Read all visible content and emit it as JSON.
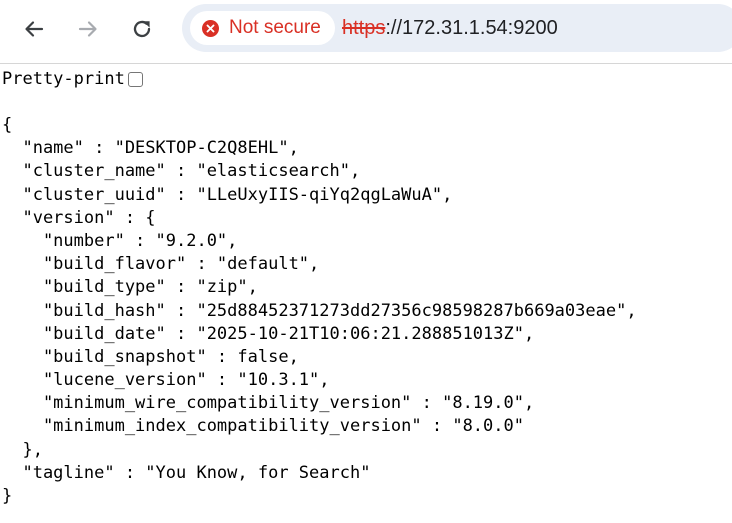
{
  "browser": {
    "security_label": "Not secure",
    "url_scheme": "https",
    "url_rest": "://172.31.1.54:9200",
    "colors": {
      "warning_red": "#d93025",
      "omnibox_bg": "#e9eef6"
    },
    "icons": [
      "back-arrow-icon",
      "forward-arrow-icon",
      "reload-icon",
      "not-secure-warning-icon"
    ]
  },
  "page": {
    "pretty_print_label": "Pretty-print",
    "pretty_print_checked": false,
    "json_lines": [
      "{",
      "  \"name\" : \"DESKTOP-C2Q8EHL\",",
      "  \"cluster_name\" : \"elasticsearch\",",
      "  \"cluster_uuid\" : \"LLeUxyIIS-qiYq2qgLaWuA\",",
      "  \"version\" : {",
      "    \"number\" : \"9.2.0\",",
      "    \"build_flavor\" : \"default\",",
      "    \"build_type\" : \"zip\",",
      "    \"build_hash\" : \"25d88452371273dd27356c98598287b669a03eae\",",
      "    \"build_date\" : \"2025-10-21T10:06:21.288851013Z\",",
      "    \"build_snapshot\" : false,",
      "    \"lucene_version\" : \"10.3.1\",",
      "    \"minimum_wire_compatibility_version\" : \"8.19.0\",",
      "    \"minimum_index_compatibility_version\" : \"8.0.0\"",
      "  },",
      "  \"tagline\" : \"You Know, for Search\"",
      "}"
    ]
  }
}
